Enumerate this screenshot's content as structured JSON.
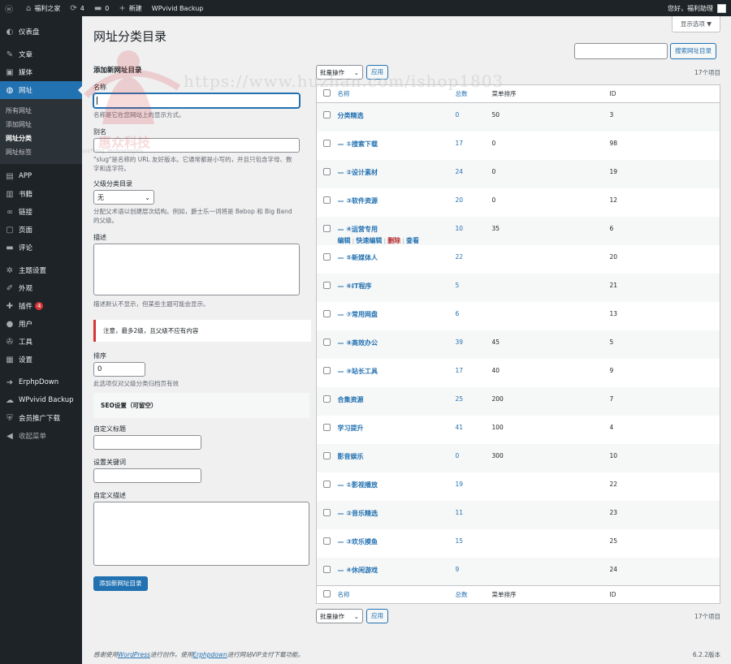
{
  "adminbar": {
    "site_name": "福利之家",
    "updates_count": "4",
    "comments_count": "0",
    "new_label": "新建",
    "plugin_label": "WPvivid Backup",
    "greeting": "您好，福利助理"
  },
  "sidebar": {
    "items": [
      {
        "label": "仪表盘",
        "icon": "dashboard-icon",
        "glyph": "◐"
      },
      {
        "label": "文章",
        "icon": "pin-icon",
        "glyph": "✎"
      },
      {
        "label": "媒体",
        "icon": "media-icon",
        "glyph": "▣"
      },
      {
        "label": "网址",
        "icon": "globe-icon",
        "glyph": "◍"
      },
      {
        "label": "APP",
        "icon": "app-icon",
        "glyph": "▤"
      },
      {
        "label": "书籍",
        "icon": "book-icon",
        "glyph": "▥"
      },
      {
        "label": "链接",
        "icon": "link-icon",
        "glyph": "∞"
      },
      {
        "label": "页面",
        "icon": "page-icon",
        "glyph": "▢"
      },
      {
        "label": "评论",
        "icon": "comment-icon",
        "glyph": "▬"
      },
      {
        "label": "主题设置",
        "icon": "gear-icon",
        "glyph": "✲"
      },
      {
        "label": "外观",
        "icon": "brush-icon",
        "glyph": "✐"
      },
      {
        "label": "插件",
        "icon": "plugin-icon",
        "glyph": "✚",
        "badge": "4"
      },
      {
        "label": "用户",
        "icon": "user-icon",
        "glyph": "●"
      },
      {
        "label": "工具",
        "icon": "wrench-icon",
        "glyph": "✇"
      },
      {
        "label": "设置",
        "icon": "settings-icon",
        "glyph": "▦"
      },
      {
        "label": "ErphpDown",
        "icon": "erphpdown-icon",
        "glyph": "➜"
      },
      {
        "label": "WPvivid Backup",
        "icon": "cloud-icon",
        "glyph": "☁"
      },
      {
        "label": "会员推广下载",
        "icon": "shield-icon",
        "glyph": "⛨"
      },
      {
        "label": "收起菜单",
        "icon": "collapse-icon",
        "glyph": "◀"
      }
    ],
    "submenu": [
      "所有网址",
      "添加网址",
      "网址分类",
      "网址标签"
    ]
  },
  "main": {
    "screen_options": "显示选项 ▼",
    "title": "网址分类目录",
    "search_button": "搜索网址目录"
  },
  "form": {
    "heading": "添加新网址目录",
    "name_label": "名称",
    "name_desc": "名称是它在您网站上的显示方式。",
    "slug_label": "别名",
    "slug_desc": "\"slug\"是名称的 URL 友好版本。它通常都是小写的，并且只包含字母、数字和连字符。",
    "parent_label": "父级分类目录",
    "parent_value": "无",
    "parent_desc": "分配父术语以创建层次结构。例如，爵士乐一词将是 Bebop 和 Big Band 的父级。",
    "description_label": "描述",
    "description_desc": "描述默认不显示，但某些主题可能会显示。",
    "notice": "注意，最多2级，且父级不应有内容",
    "order_label": "排序",
    "order_value": "0",
    "order_desc": "此选项仅对父级分类归档页有效",
    "seo_heading": "SEO设置（可留空）",
    "seo_title_label": "自定义标题",
    "seo_keywords_label": "设置关键词",
    "seo_desc_label": "自定义描述",
    "submit": "添加新网址目录"
  },
  "table": {
    "bulk_label": "批量操作",
    "apply": "应用",
    "count": "17个项目",
    "headers": {
      "name": "名称",
      "count": "总数",
      "order": "菜单排序",
      "id": "ID"
    },
    "row_actions": {
      "edit": "编辑",
      "quick": "快速编辑",
      "delete": "删除",
      "view": "查看"
    },
    "rows": [
      {
        "name": "分类精选",
        "count": "0",
        "order": "50",
        "id": "3"
      },
      {
        "name": "— ①搜索下载",
        "count": "17",
        "order": "0",
        "id": "98"
      },
      {
        "name": "— ②设计素材",
        "count": "24",
        "order": "0",
        "id": "19"
      },
      {
        "name": "— ③软件资源",
        "count": "20",
        "order": "0",
        "id": "12"
      },
      {
        "name": "— ④运营专用",
        "count": "10",
        "order": "35",
        "id": "6"
      },
      {
        "name": "— ⑤新媒体人",
        "count": "22",
        "order": "",
        "id": "20"
      },
      {
        "name": "— ⑥IT程序",
        "count": "5",
        "order": "",
        "id": "21"
      },
      {
        "name": "— ⑦常用网盘",
        "count": "6",
        "order": "",
        "id": "13"
      },
      {
        "name": "— ⑧高效办公",
        "count": "39",
        "order": "45",
        "id": "5"
      },
      {
        "name": "— ⑨站长工具",
        "count": "17",
        "order": "40",
        "id": "9"
      },
      {
        "name": "合集资源",
        "count": "25",
        "order": "200",
        "id": "7"
      },
      {
        "name": "学习提升",
        "count": "41",
        "order": "100",
        "id": "4"
      },
      {
        "name": "影音娱乐",
        "count": "0",
        "order": "300",
        "id": "10"
      },
      {
        "name": "— ①影视播放",
        "count": "19",
        "order": "",
        "id": "22"
      },
      {
        "name": "— ②音乐精选",
        "count": "11",
        "order": "",
        "id": "23"
      },
      {
        "name": "— ③欢乐摸鱼",
        "count": "15",
        "order": "",
        "id": "25"
      },
      {
        "name": "— ④休闲游戏",
        "count": "9",
        "order": "",
        "id": "24"
      }
    ]
  },
  "footer": {
    "text_before": "感谢使用",
    "link1": "WordPress",
    "text_mid": "进行创作。使用",
    "link2": "Erphpdown",
    "text_after": "进行网站VIP支付下载功能。",
    "version": "6.2.2版本"
  },
  "watermark": {
    "url": "https://www.huzhan.com/ishop1803",
    "logo_text": "惠众科技",
    "logo_sub": "Huizhong Technologies"
  }
}
